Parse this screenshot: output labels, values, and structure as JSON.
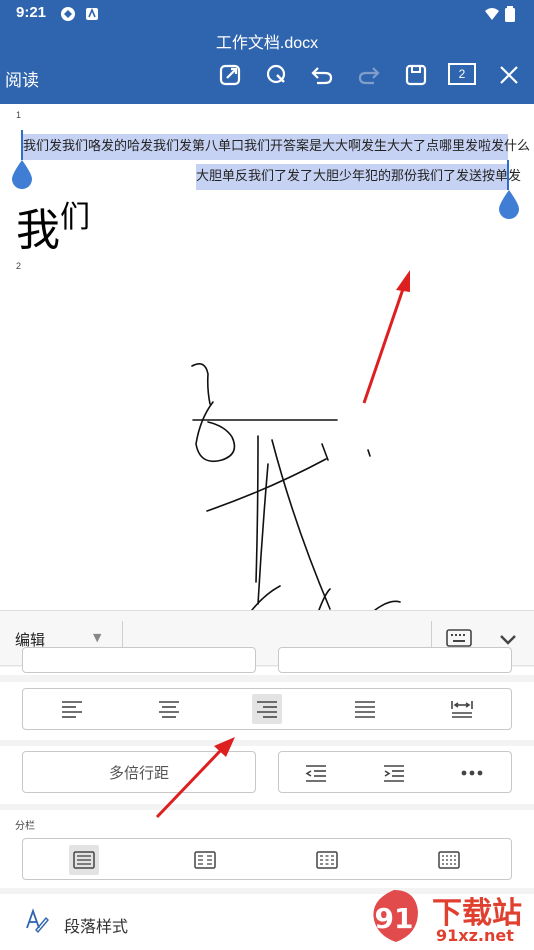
{
  "status": {
    "time": "9:21"
  },
  "document": {
    "title": "工作文档.docx",
    "mode": "阅读",
    "page_count": "2",
    "page_marker_1": "1",
    "page_marker_2": "2",
    "selected_line_1": "我们发我们咯发的哈发我们发第八单口我们开答案是大大啊发生大大了点哪里发啦发什么",
    "selected_line_2": "大胆单反我们了发了大胆少年犯的那份我们了发送按单发",
    "big_text_1": "我",
    "big_text_2": "们"
  },
  "sheet": {
    "edit_label": "编辑",
    "line_spacing_label": "多倍行距",
    "columns_label": "分栏",
    "paragraph_style_label": "段落样式"
  },
  "watermark": {
    "brand": "下载站",
    "url": "91xz.net",
    "digits": "91"
  },
  "colors": {
    "toolbar": "#2f65ae",
    "selection": "#c6d2f3",
    "handle": "#3f7ed4",
    "arrow": "#dd1f1f"
  }
}
